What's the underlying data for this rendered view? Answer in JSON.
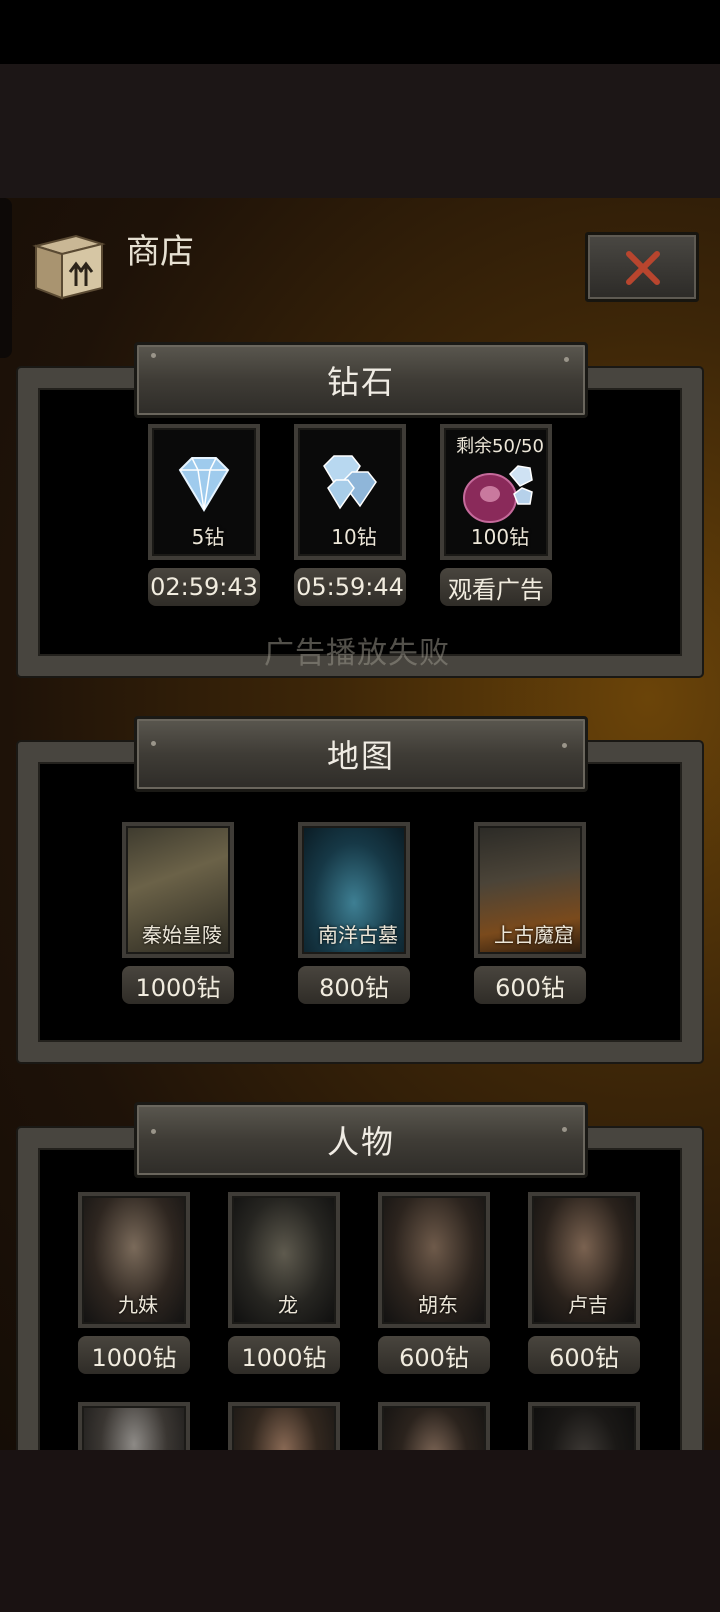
{
  "shop": {
    "title": "商店"
  },
  "toast": "广告播放失败",
  "sections": {
    "diamond": {
      "title": "钻石",
      "items": [
        {
          "label": "5钻",
          "price": "02:59:43",
          "icon": "diamond-icon"
        },
        {
          "label": "10钻",
          "price": "05:59:44",
          "icon": "diamond-pile-icon"
        },
        {
          "label": "100钻",
          "price": "观看广告",
          "remain": "剩余50/50",
          "icon": "diamond-bag-icon"
        }
      ]
    },
    "map": {
      "title": "地图",
      "items": [
        {
          "label": "秦始皇陵",
          "price": "1000钻"
        },
        {
          "label": "南洋古墓",
          "price": "800钻"
        },
        {
          "label": "上古魔窟",
          "price": "600钻"
        }
      ]
    },
    "character": {
      "title": "人物",
      "items": [
        {
          "label": "九妹",
          "price": "1000钻"
        },
        {
          "label": "龙",
          "price": "1000钻"
        },
        {
          "label": "胡东",
          "price": "600钻"
        },
        {
          "label": "卢吉",
          "price": "600钻"
        }
      ]
    }
  },
  "colors": {
    "accent_close": "#b8452e",
    "frame": "#48453f",
    "text": "#f1ecdf"
  }
}
